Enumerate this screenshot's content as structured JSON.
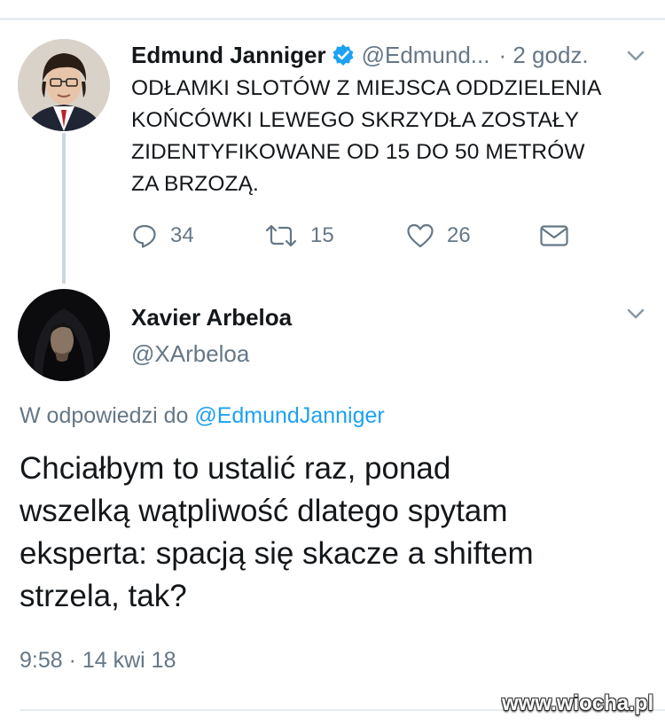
{
  "tweet1": {
    "name": "Edmund Janniger",
    "handle": "@Edmund...",
    "time": "· 2 godz.",
    "body_lines": [
      "ODŁAMKI SLOTÓW Z MIEJSCA ODDZIELENIA",
      "KOŃCÓWKI LEWEGO SKRZYDŁA ZOSTAŁY",
      "ZIDENTYFIKOWANE OD 15 DO 50 METRÓW",
      "ZA BRZOZĄ."
    ],
    "actions": {
      "reply_count": "34",
      "retweet_count": "15",
      "like_count": "26"
    }
  },
  "tweet2": {
    "name": "Xavier Arbeloa",
    "handle": "@XArbeloa",
    "reply_prefix": "W odpowiedzi do",
    "reply_target": "@EdmundJanniger",
    "body_lines": [
      "Chciałbym to ustalić raz, ponad",
      "wszelką wątpliwość dlatego spytam",
      "eksperta: spacją się skacze a shiftem",
      "strzela, tak?"
    ],
    "timestamp": "9:58 · 14 kwi 18"
  },
  "watermark": "www.wiocha.pl",
  "colors": {
    "link": "#1da1f2",
    "secondary_text": "#657786",
    "primary_text": "#14171a",
    "divider": "#e6ecf0"
  },
  "icons": [
    "verified-badge-icon",
    "chevron-down-icon",
    "reply-icon",
    "retweet-icon",
    "like-heart-icon",
    "direct-message-icon"
  ]
}
